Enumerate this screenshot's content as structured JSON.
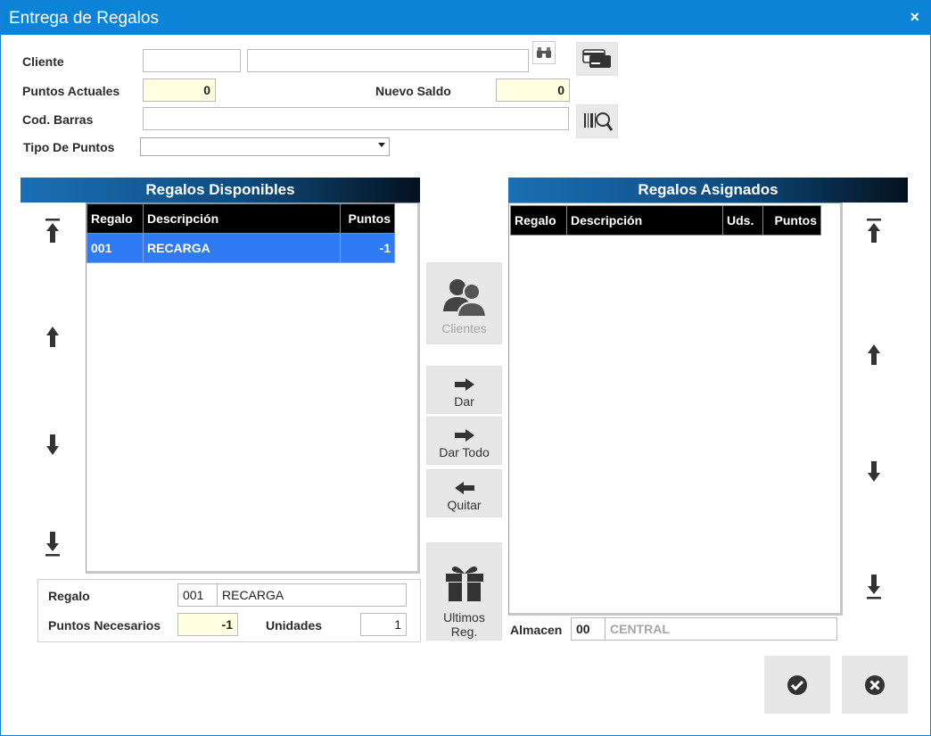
{
  "window": {
    "title": "Entrega de Regalos",
    "close_glyph": "×"
  },
  "form": {
    "cliente_label": "Cliente",
    "cliente_code": "",
    "cliente_name": "",
    "puntos_actuales_label": "Puntos Actuales",
    "puntos_actuales": "0",
    "nuevo_saldo_label": "Nuevo Saldo",
    "nuevo_saldo": "0",
    "cod_barras_label": "Cod. Barras",
    "cod_barras": "",
    "tipo_puntos_label": "Tipo De Puntos",
    "tipo_puntos": ""
  },
  "disponibles": {
    "title": "Regalos Disponibles",
    "columns": [
      "Regalo",
      "Descripción",
      "Puntos"
    ],
    "rows": [
      {
        "regalo": "001",
        "descripcion": "RECARGA",
        "puntos": "-1"
      }
    ]
  },
  "asignados": {
    "title": "Regalos Asignados",
    "columns": [
      "Regalo",
      "Descripción",
      "Uds.",
      "Puntos"
    ]
  },
  "detail": {
    "regalo_label": "Regalo",
    "regalo_code": "001",
    "regalo_desc": "RECARGA",
    "puntos_necesarios_label": "Puntos Necesarios",
    "puntos_necesarios": "-1",
    "unidades_label": "Unidades",
    "unidades": "1"
  },
  "middle": {
    "clientes": "Clientes",
    "dar": "Dar",
    "dar_todo": "Dar Todo",
    "quitar": "Quitar",
    "ultimos_1": "Ultimos",
    "ultimos_2": "Reg."
  },
  "almacen": {
    "label": "Almacen",
    "code": "00",
    "name": "CENTRAL"
  },
  "icons": {
    "binoculars": "binoculars-icon",
    "cards": "credit-cards-icon",
    "barcode": "barcode-search-icon",
    "users": "users-icon",
    "gift": "gift-icon",
    "ok": "check-circle-icon",
    "cancel": "x-circle-icon"
  },
  "colors": {
    "titlebar": "#0b84d8",
    "selected_row": "#2f7bf4",
    "yellow_field": "#ffffe1"
  }
}
